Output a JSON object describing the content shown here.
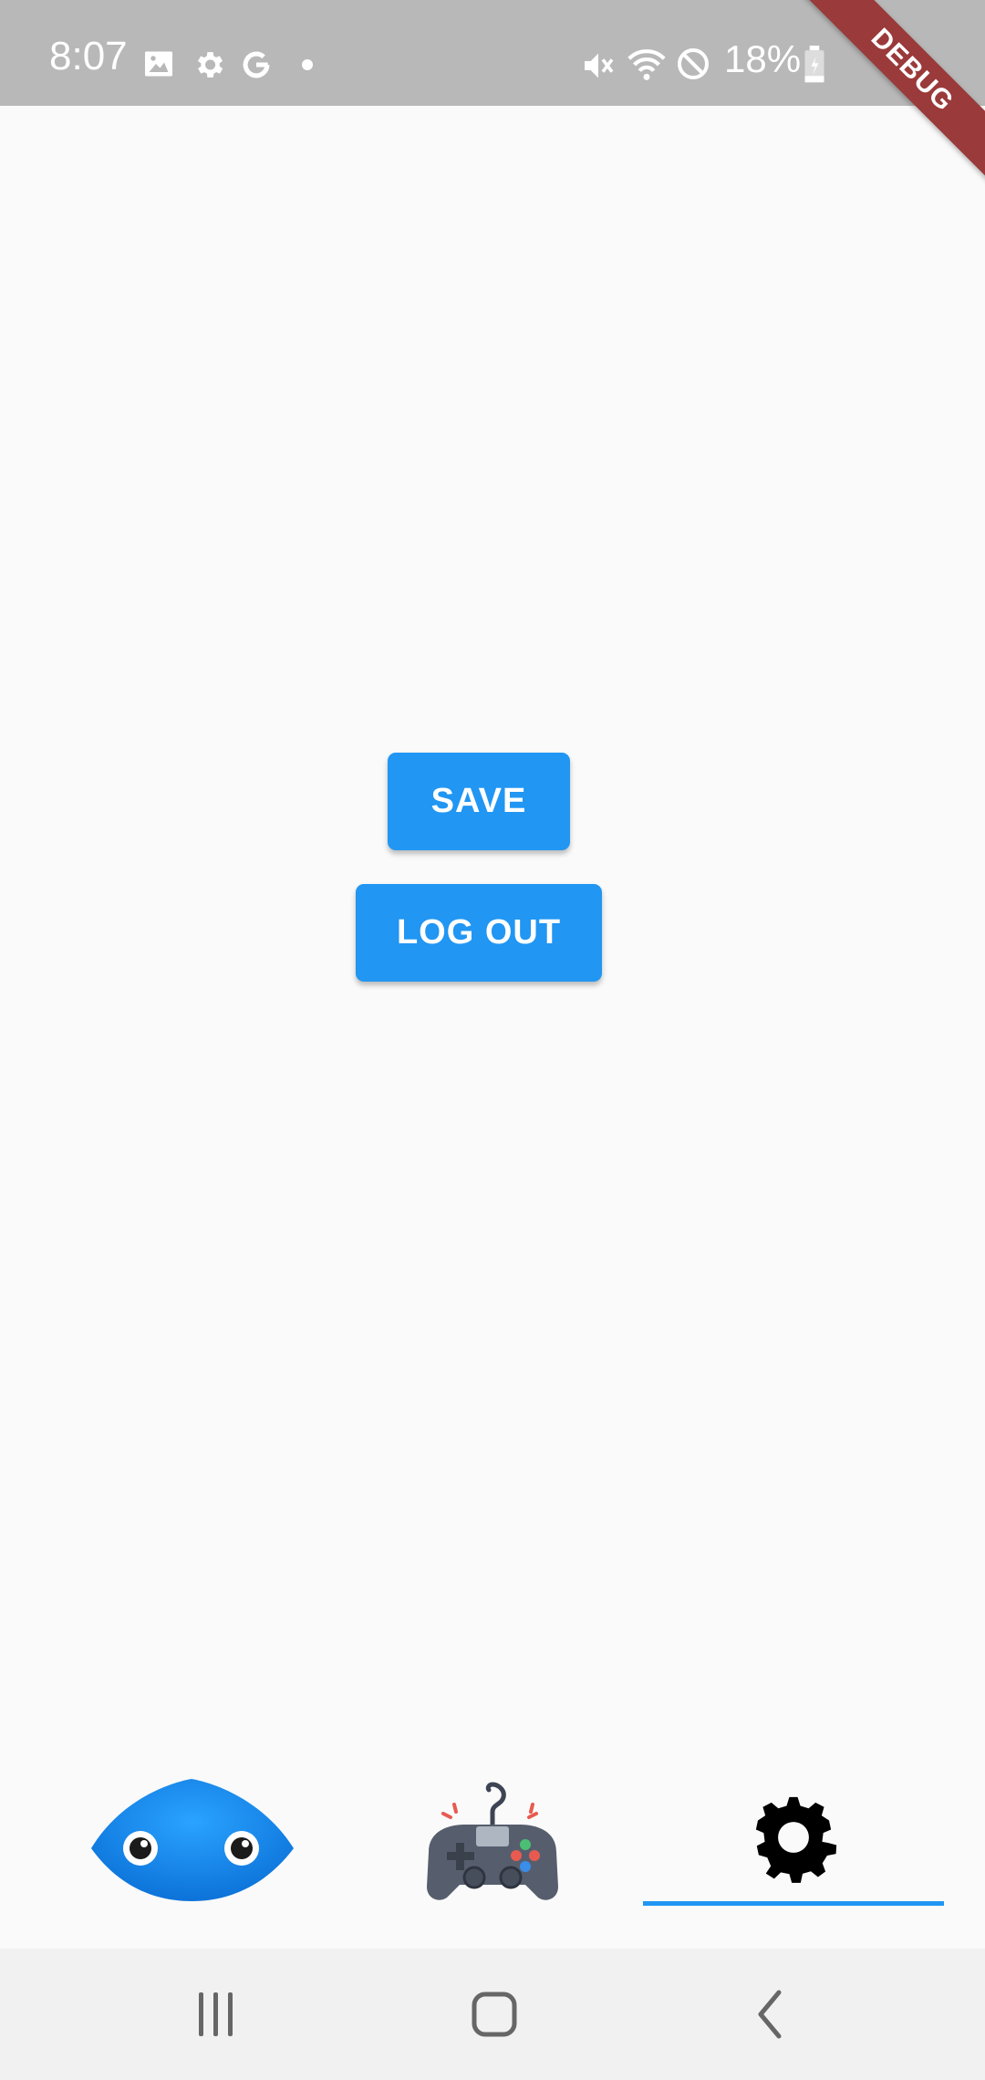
{
  "status_bar": {
    "time": "8:07",
    "battery": "18%",
    "icons": [
      "image-icon",
      "settings-icon",
      "google-icon",
      "dot-icon",
      "mute-icon",
      "wifi-icon",
      "blocked-icon",
      "battery-icon"
    ]
  },
  "debug_banner": "DEBUG",
  "actions": {
    "save_label": "SAVE",
    "logout_label": "LOG OUT"
  },
  "tabs": [
    {
      "name": "blob",
      "icon": "blue-blob-character-icon"
    },
    {
      "name": "game",
      "icon": "gamepad-icon"
    },
    {
      "name": "settings",
      "icon": "gear-icon",
      "selected": true
    }
  ],
  "colors": {
    "accent": "#2196f3",
    "status_bar": "#b8b8b8",
    "background": "#fafafa",
    "nav_bar": "#f1f1f1",
    "debug": "#9a3a3a"
  },
  "nav_buttons": [
    "recents-icon",
    "home-icon",
    "back-icon"
  ]
}
